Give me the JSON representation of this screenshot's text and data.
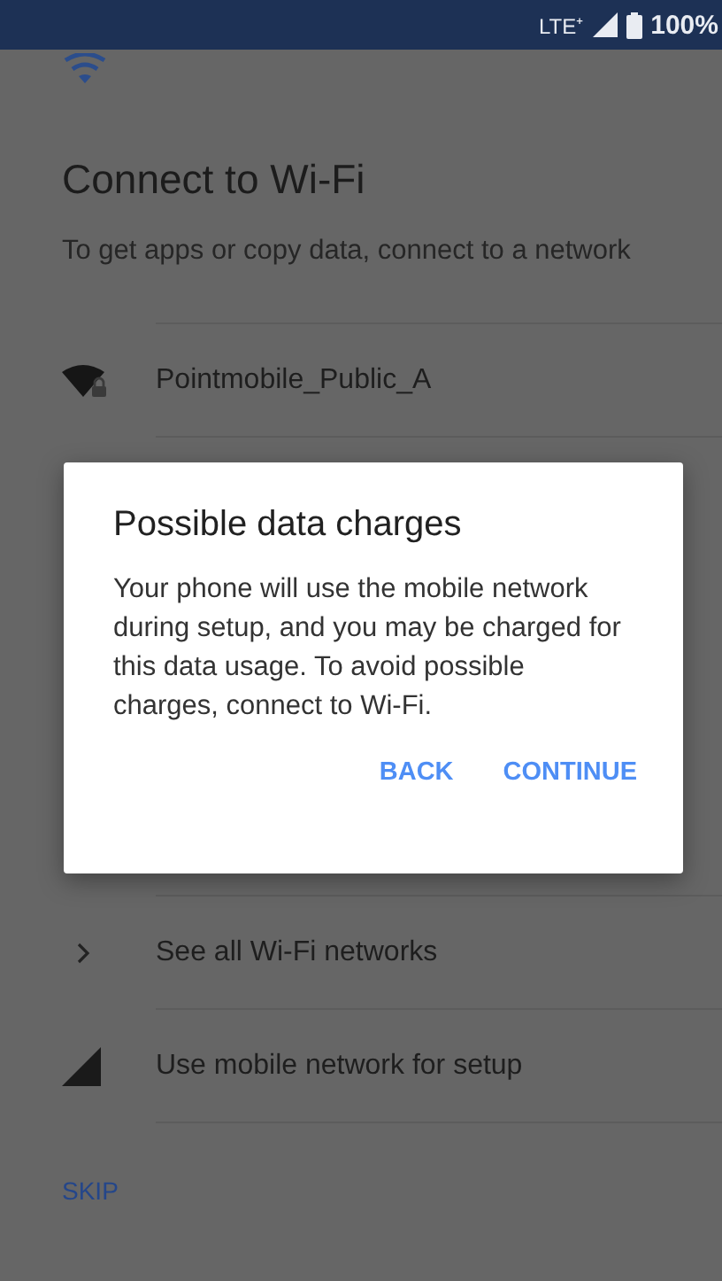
{
  "status_bar": {
    "network": "LTE⁺",
    "battery": "100%"
  },
  "title": "Connect to Wi-Fi",
  "subtitle": "To get apps or copy data, connect to a network",
  "networks_top": [
    {
      "kind": "wifi-locked",
      "label": "Pointmobile_Public_A"
    }
  ],
  "networks_bottom": [
    {
      "kind": "all-networks",
      "label": "See all Wi-Fi networks"
    },
    {
      "kind": "mobile",
      "label": "Use mobile network for setup"
    }
  ],
  "skip": "SKIP",
  "dialog": {
    "title": "Possible data charges",
    "message": "Your phone will use the mobile network during setup, and you may be charged for this data usage. To avoid possible charges, connect to Wi-Fi.",
    "buttons": [
      "BACK",
      "CONTINUE"
    ]
  }
}
